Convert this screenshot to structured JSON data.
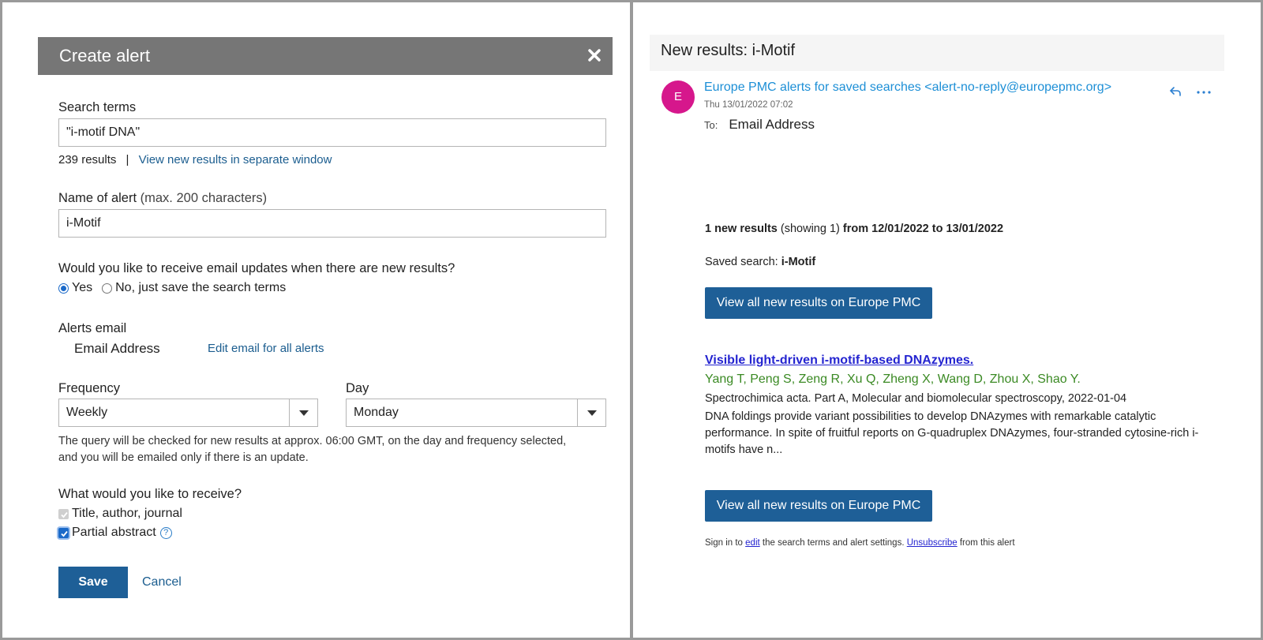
{
  "create_alert": {
    "title": "Create alert",
    "search_terms_label": "Search terms",
    "search_terms_value": "\"i-motif DNA\"",
    "results_count": "239 results",
    "separator": "|",
    "view_new_results_link": "View new results in separate window",
    "name_label": "Name of alert",
    "name_hint": "(max. 200 characters)",
    "name_value": "i-Motif",
    "email_question": "Would you like to receive email updates when there are new results?",
    "radio_yes": "Yes",
    "radio_no": "No, just save the search terms",
    "alerts_email_label": "Alerts email",
    "alerts_email_value": "Email Address",
    "edit_email_link": "Edit email for all alerts",
    "frequency_label": "Frequency",
    "frequency_value": "Weekly",
    "day_label": "Day",
    "day_value": "Monday",
    "schedule_help": "The query will be checked for new results at approx. 06:00 GMT, on the day and frequency selected, and you will be emailed only if there is an update.",
    "receive_question": "What would you like to receive?",
    "option_title": "Title, author, journal",
    "option_abstract": "Partial abstract",
    "help_symbol": "?",
    "save_label": "Save",
    "cancel_label": "Cancel"
  },
  "email": {
    "subject": "New results: i-Motif",
    "avatar_letter": "E",
    "sender": "Europe PMC alerts for saved searches <alert-no-reply@europepmc.org>",
    "date": "Thu 13/01/2022 07:02",
    "to_label": "To:",
    "to_value": "Email Address",
    "summary_count": "1 new results",
    "summary_showing": "(showing 1)",
    "summary_range": "from 12/01/2022 to 13/01/2022",
    "saved_label": "Saved search:",
    "saved_value": "i-Motif",
    "view_all_label": "View all new results on Europe PMC",
    "article_title": "Visible light-driven i-motif-based DNAzymes.",
    "article_authors": "Yang T, Peng S, Zeng R, Xu Q, Zheng X, Wang D, Zhou X, Shao Y.",
    "article_journal": "Spectrochimica acta. Part A, Molecular and biomolecular spectroscopy, 2022-01-04",
    "article_abstract": "DNA foldings provide variant possibilities to develop DNAzymes with remarkable catalytic performance. In spite of fruitful reports on G-quadruplex DNAzymes, four-stranded cytosine-rich i-motifs have n...",
    "footer_sign_in": "Sign in to",
    "footer_edit": "edit",
    "footer_middle": "the search terms and alert settings.",
    "footer_unsubscribe": "Unsubscribe",
    "footer_end": "from this alert"
  },
  "icons": {
    "close": "close-icon",
    "dropdown": "chevron-down-icon",
    "reply": "reply-icon",
    "more": "more-icon",
    "help": "help-icon"
  },
  "colors": {
    "header_bg": "#767676",
    "primary_button": "#1e5f97",
    "link": "#1b5d8f",
    "avatar": "#d6178c",
    "sender": "#1d8fd6",
    "article_title": "#2424d0",
    "authors": "#3b8a24"
  }
}
